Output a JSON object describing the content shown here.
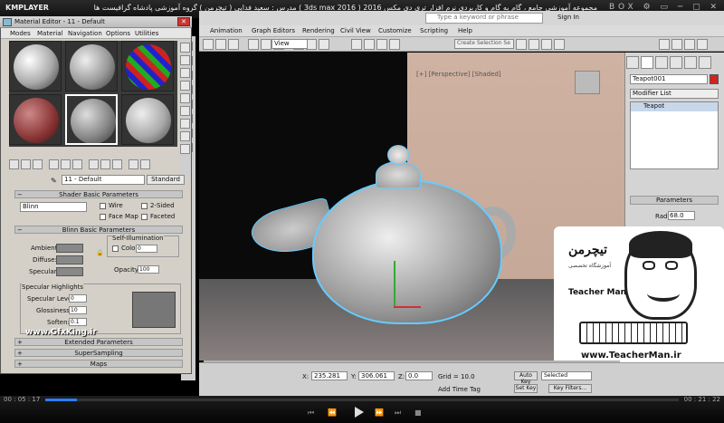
{
  "player": {
    "logo": "KMPLAYER",
    "caption": "مجموعه آموزشی جامع ، گام به گام و کاربردی نرم افزار تری دی مکس 2016 ( 3ds max 2016 ) مدرس : سعید فدایی ( تیچرمن ) گروه آموزشی پادشاه گرافیست ها",
    "window_controls": "BOX ⚙ ▭ ─ ▢ ✕",
    "time_current": "00 : 05 : 17",
    "time_total": "00 : 21 : 22",
    "controls": [
      "⏮",
      "⏪",
      "⏩",
      "⏭",
      "■"
    ],
    "progress": 0.05
  },
  "max": {
    "search_placeholder": "Type a keyword or phrase",
    "sign_in": "Sign In",
    "menus": [
      "Animation",
      "Graph Editors",
      "Rendering",
      "Civil View",
      "Customize",
      "Scripting",
      "Help"
    ],
    "view_dropdown": "View",
    "selection_set": "Create Selection Se",
    "viewport_label": "[+] [Perspective] [Shaded]",
    "command_panel": {
      "object_name": "Teapot001",
      "object_color": "#d22222",
      "modifier_list": "Modifier List",
      "stack_item": "Teapot",
      "parameters": "Parameters",
      "radius_label": "Radius:",
      "radius_value": "68.0"
    },
    "status": {
      "x_label": "X:",
      "x_value": "235.281",
      "y_label": "Y:",
      "y_value": "306.061",
      "z_label": "Z:",
      "z_value": "0.0",
      "grid": "Grid = 10.0",
      "add_time_tag": "Add Time Tag",
      "auto_key": "Auto Key",
      "set_key": "Set Key",
      "selected": "Selected",
      "key_filters": "Key Filters..."
    }
  },
  "material_editor": {
    "title": "Material Editor - 11 - Default",
    "close": "✕",
    "menus": [
      "Modes",
      "Material",
      "Navigation",
      "Options",
      "Utilities"
    ],
    "material_name": "11 - Default",
    "material_type": "Standard",
    "rollouts": {
      "shader_basic": "Shader Basic Parameters",
      "blinn_basic": "Blinn Basic Parameters",
      "extended": "Extended Parameters",
      "supersampling": "SuperSampling",
      "maps": "Maps"
    },
    "shader": "Blinn",
    "checkboxes": {
      "wire": "Wire",
      "two_sided": "2-Sided",
      "face_map": "Face Map",
      "faceted": "Faceted"
    },
    "basic": {
      "ambient": "Ambient:",
      "diffuse": "Diffuse:",
      "specular": "Specular:",
      "self_illum": "Self-Illumination",
      "color": "Color",
      "color_value": "0",
      "opacity": "Opacity:",
      "opacity_value": "100"
    },
    "specular": {
      "title": "Specular Highlights",
      "level_label": "Specular Level:",
      "level_value": "0",
      "gloss_label": "Glossiness:",
      "gloss_value": "10",
      "soften_label": "Soften:",
      "soften_value": "0.1"
    },
    "watermark": "www.GfxKing.ir"
  },
  "overlay": {
    "logo_persian": "تیچرمن",
    "subtitle": "آموزشگاه تخصصی",
    "logo_english": "Teacher Man",
    "url": "www.TeacherMan.ir"
  }
}
